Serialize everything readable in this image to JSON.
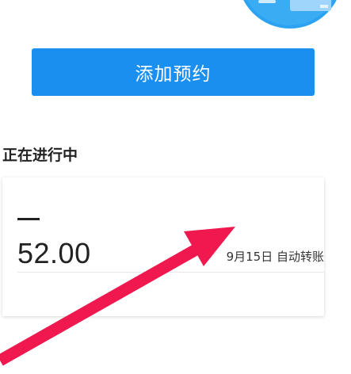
{
  "colors": {
    "primary": "#1a8ff0",
    "annotation_arrow": "#f0194f",
    "illustration_blue": "#2ba3f2",
    "illustration_light": "#bfe3fb"
  },
  "header": {
    "illustration_icon": "card-illustration"
  },
  "actions": {
    "add_label": "添加预约"
  },
  "section": {
    "title": "正在进行中"
  },
  "items": [
    {
      "dash": "—",
      "amount": "52.00",
      "schedule": "9月15日 自动转账"
    }
  ],
  "annotation": {
    "icon": "arrow-pointer"
  }
}
